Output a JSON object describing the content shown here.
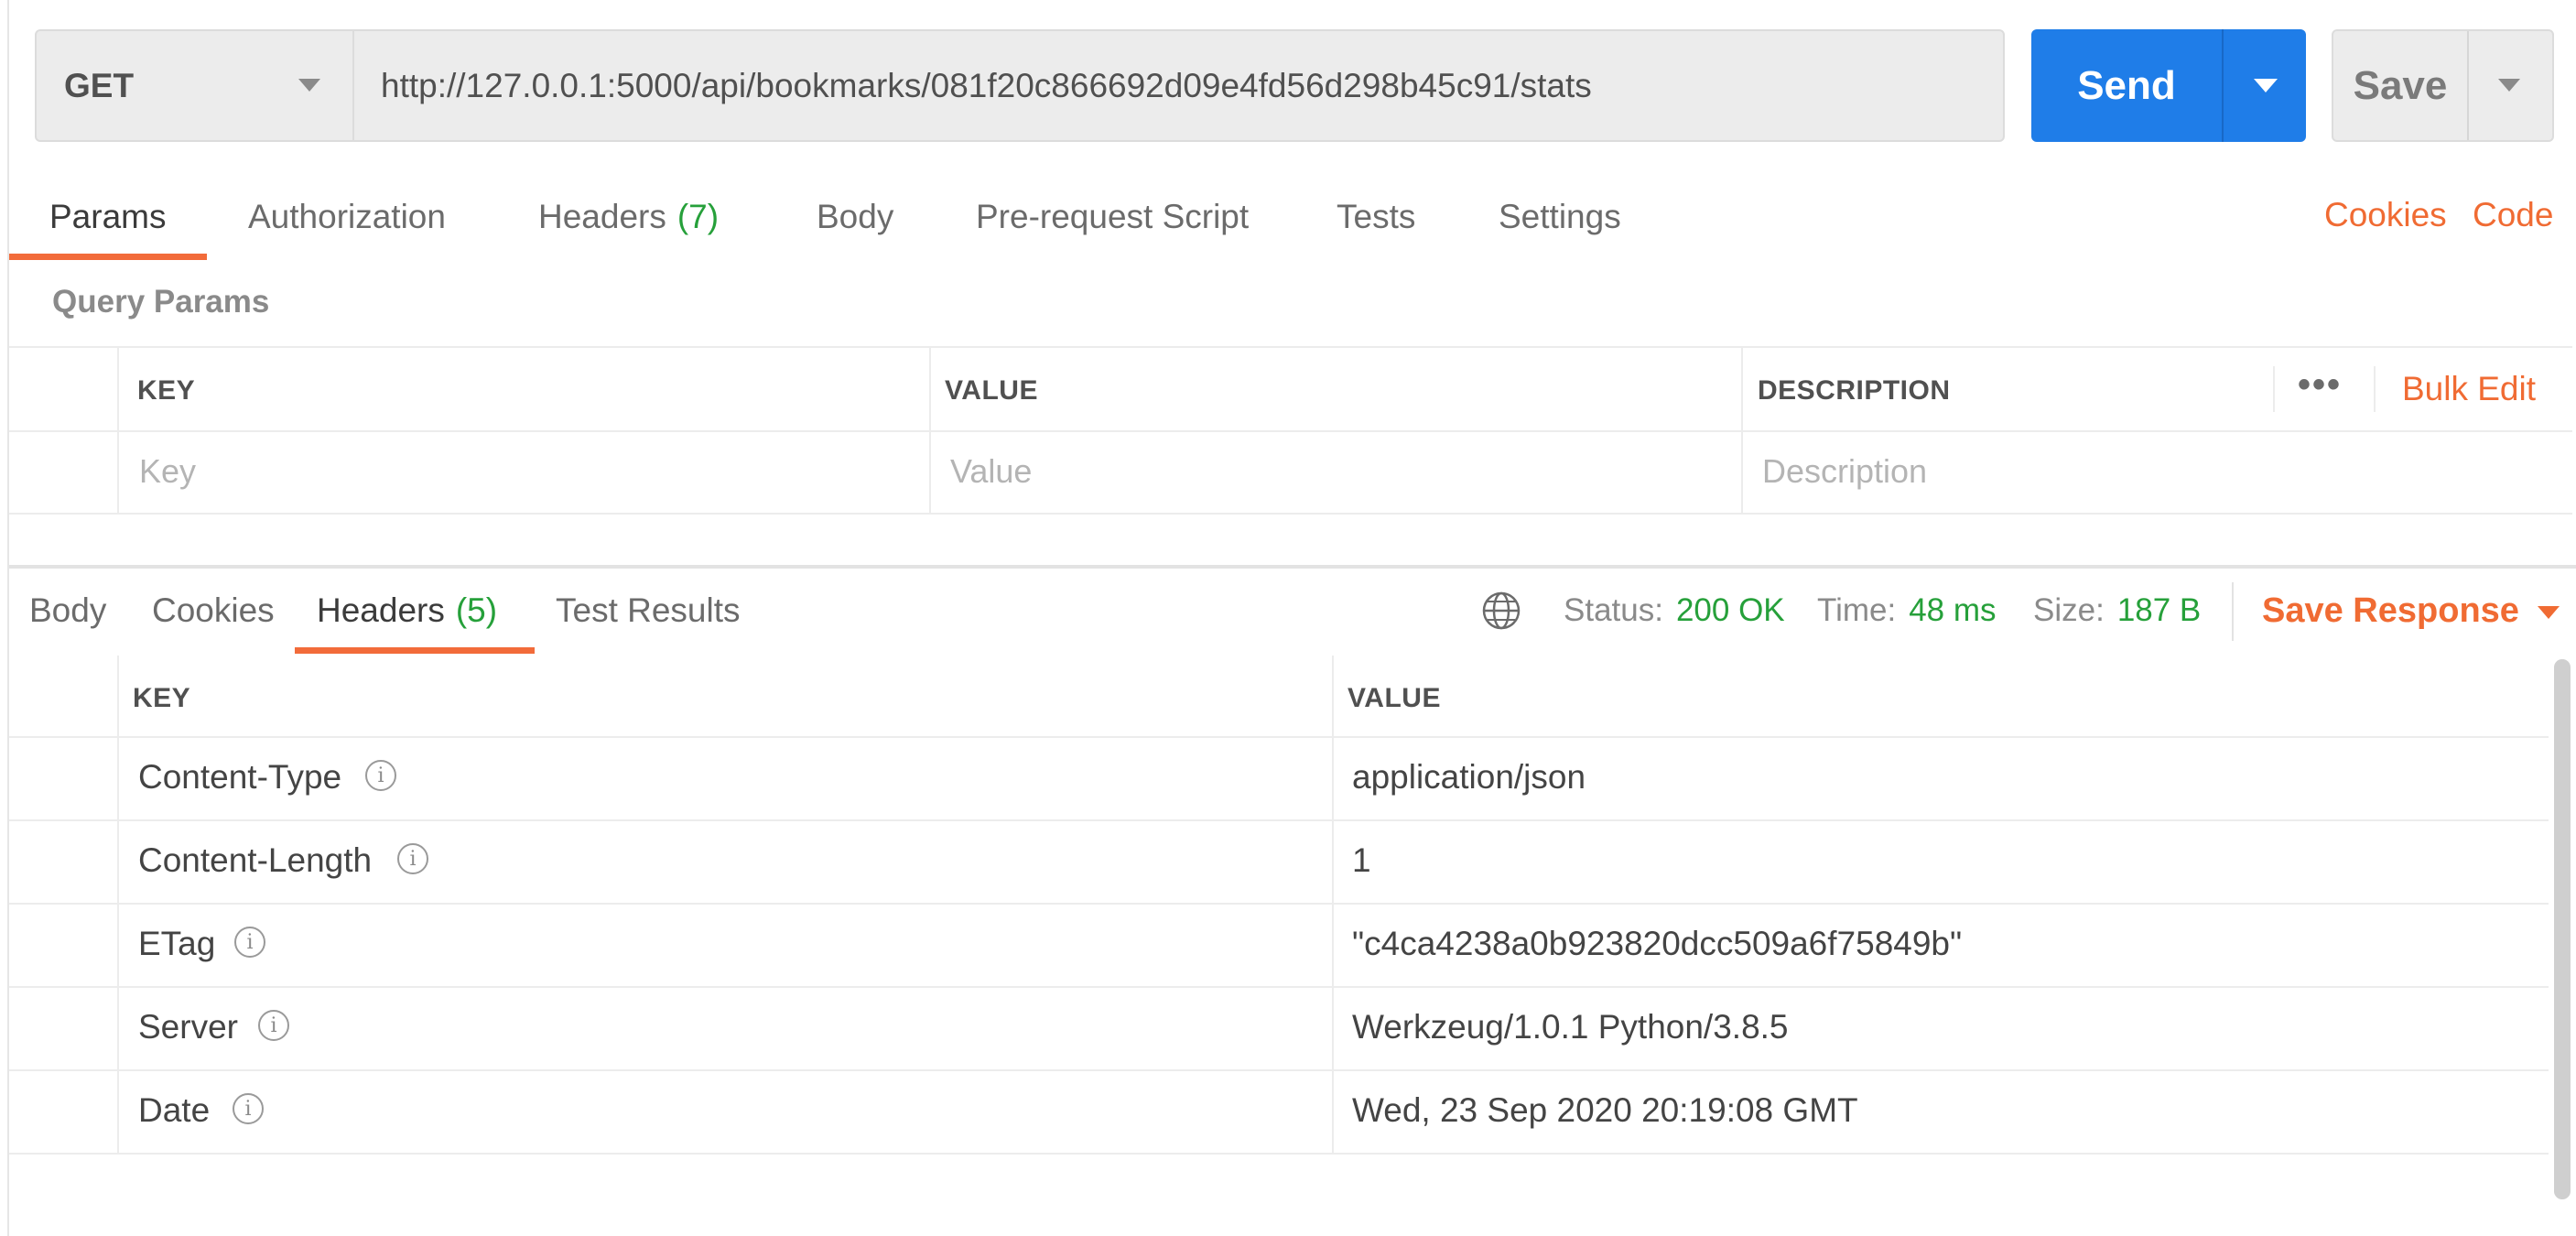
{
  "request": {
    "method": "GET",
    "url": "http://127.0.0.1:5000/api/bookmarks/081f20c866692d09e4fd56d298b45c91/stats",
    "send_label": "Send",
    "save_label": "Save"
  },
  "request_tabs": {
    "params": "Params",
    "authorization": "Authorization",
    "headers": "Headers",
    "headers_count": "(7)",
    "body": "Body",
    "prerequest": "Pre-request Script",
    "tests": "Tests",
    "settings": "Settings",
    "cookies": "Cookies",
    "code": "Code"
  },
  "query_params": {
    "title": "Query Params",
    "columns": [
      "KEY",
      "VALUE",
      "DESCRIPTION"
    ],
    "bulk_edit": "Bulk Edit",
    "more": "•••",
    "placeholders": {
      "key": "Key",
      "value": "Value",
      "description": "Description"
    }
  },
  "response_tabs": {
    "body": "Body",
    "cookies": "Cookies",
    "headers": "Headers",
    "headers_count": "(5)",
    "test_results": "Test Results"
  },
  "response_meta": {
    "status_label": "Status:",
    "status": "200 OK",
    "time_label": "Time:",
    "time": "48 ms",
    "size_label": "Size:",
    "size": "187 B",
    "save_response": "Save Response"
  },
  "response_headers": {
    "columns": [
      "KEY",
      "VALUE"
    ],
    "rows": [
      {
        "key": "Content-Type",
        "value": "application/json"
      },
      {
        "key": "Content-Length",
        "value": "1"
      },
      {
        "key": "ETag",
        "value": "\"c4ca4238a0b923820dcc509a6f75849b\""
      },
      {
        "key": "Server",
        "value": "Werkzeug/1.0.1 Python/3.8.5"
      },
      {
        "key": "Date",
        "value": "Wed, 23 Sep 2020 20:19:08 GMT"
      }
    ]
  },
  "colors": {
    "accent": "#f26b3a",
    "send": "#1f7de8",
    "success": "#26a03a"
  },
  "icons": {
    "info": "i",
    "globe": "globe-icon"
  }
}
